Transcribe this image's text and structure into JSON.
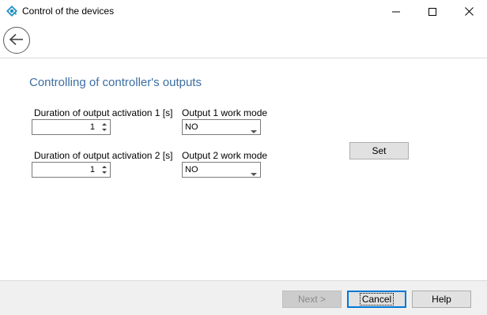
{
  "window": {
    "title": "Control of the devices",
    "controls": {
      "minimize_icon": "minimize-icon",
      "maximize_icon": "maximize-icon",
      "close_icon": "close-icon"
    }
  },
  "nav": {
    "back_icon": "arrow-left-icon"
  },
  "main": {
    "heading": "Controlling of controller's outputs",
    "outputs": [
      {
        "duration_label": "Duration of output activation 1 [s]",
        "duration_value": "1",
        "mode_label": "Output 1 work mode",
        "mode_value": "NO"
      },
      {
        "duration_label": "Duration of output activation 2 [s]",
        "duration_value": "1",
        "mode_label": "Output 2 work mode",
        "mode_value": "NO"
      }
    ],
    "set_label": "Set"
  },
  "footer": {
    "next_label": "Next >",
    "cancel_label": "Cancel",
    "help_label": "Help"
  },
  "colors": {
    "heading": "#3c6ea1",
    "default_button_border": "#0078d7",
    "footer_bg": "#f0f0f0"
  }
}
